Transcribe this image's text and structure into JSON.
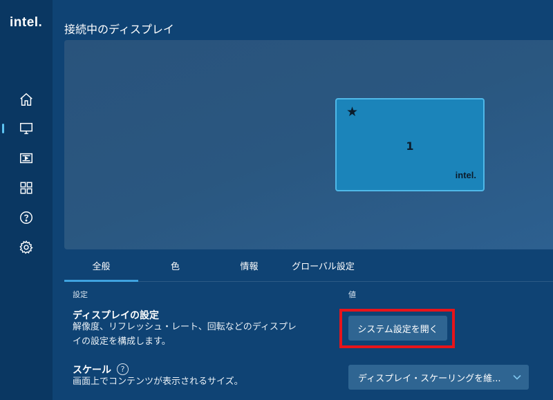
{
  "sidebar": {
    "logo": "intel.",
    "items": [
      {
        "icon": "home-icon"
      },
      {
        "icon": "display-icon",
        "active": true
      },
      {
        "icon": "video-icon"
      },
      {
        "icon": "apps-grid-icon"
      },
      {
        "icon": "help-icon"
      },
      {
        "icon": "gear-icon"
      }
    ]
  },
  "main": {
    "title": "接続中のディスプレイ",
    "monitor": {
      "star": "★",
      "number": "1",
      "logo": "intel."
    },
    "tabs": [
      {
        "label": "全般",
        "active": true
      },
      {
        "label": "色"
      },
      {
        "label": "情報"
      },
      {
        "label": "グローバル設定"
      }
    ],
    "columns": {
      "setting": "設定",
      "value": "値"
    },
    "settings": {
      "display": {
        "title": "ディスプレイの設定",
        "desc_line1": "解像度、リフレッシュ・レート、回転などのディスプレ",
        "desc_line2": "イの設定を構成します。",
        "button": "システム設定を開く"
      },
      "scale": {
        "title": "スケール",
        "help": "?",
        "desc": "画面上でコンテンツが表示されるサイズ。",
        "dropdown_value": "ディスプレイ・スケーリングを維..."
      }
    }
  },
  "colors": {
    "highlight": "#e8141a",
    "accent": "#3fa3e0",
    "monitor_fill": "#1b84ba"
  }
}
